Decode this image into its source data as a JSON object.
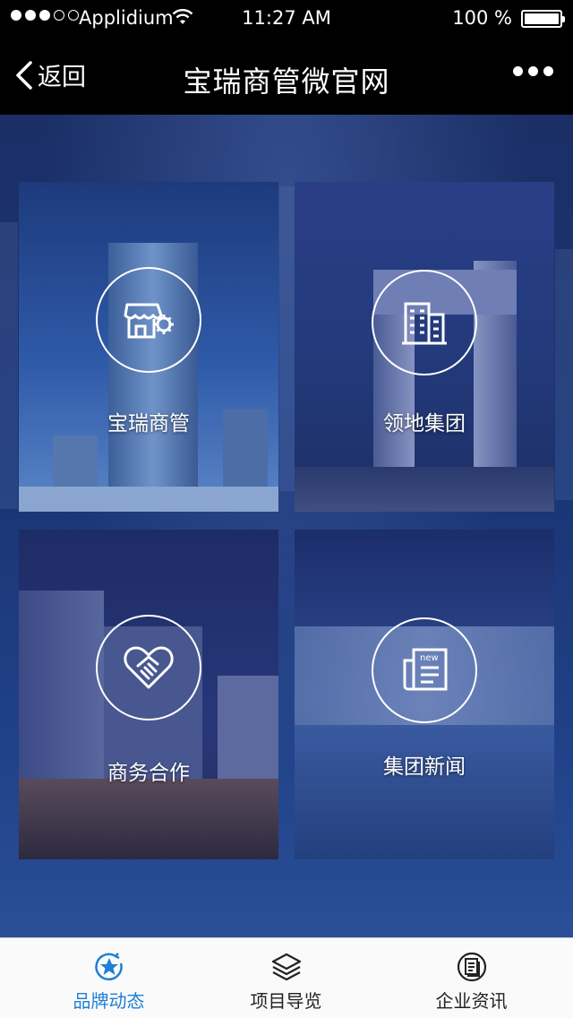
{
  "status_bar": {
    "carrier": "Applidium",
    "time": "11:27 AM",
    "battery": "100 %"
  },
  "nav": {
    "back_label": "返回",
    "title": "宝瑞商管微官网"
  },
  "tiles": [
    {
      "label": "宝瑞商管",
      "icon": "storefront-gear-icon"
    },
    {
      "label": "领地集团",
      "icon": "buildings-icon"
    },
    {
      "label": "商务合作",
      "icon": "handshake-heart-icon"
    },
    {
      "label": "集团新闻",
      "icon": "newspaper-icon"
    }
  ],
  "tabs": [
    {
      "label": "品牌动态",
      "icon": "star-badge-icon",
      "active": true
    },
    {
      "label": "项目导览",
      "icon": "layers-icon",
      "active": false
    },
    {
      "label": "企业资讯",
      "icon": "document-icon",
      "active": false
    }
  ],
  "colors": {
    "accent": "#1e7fd6",
    "nav_background": "#000000",
    "main_background": "#1a3575"
  }
}
